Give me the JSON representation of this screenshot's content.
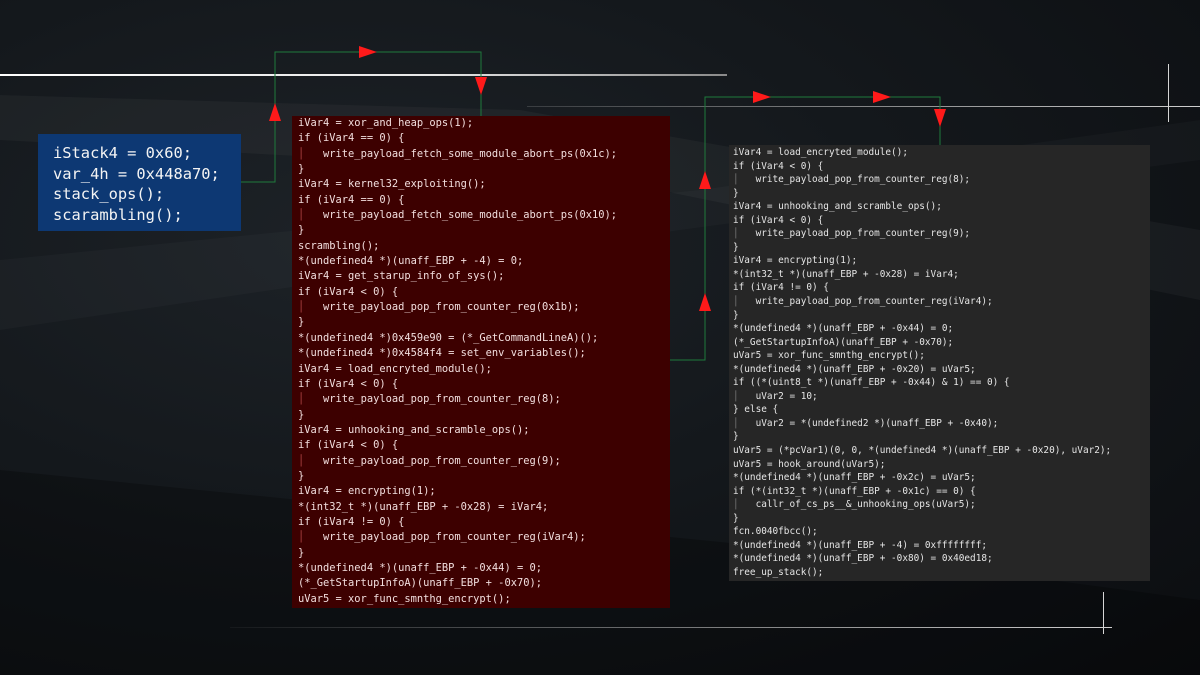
{
  "intro_block": {
    "lines": [
      "iStack4 = 0x60;",
      "var_4h = 0x448a70;",
      "stack_ops();",
      "scarambling();"
    ]
  },
  "main_block": {
    "lines": [
      "iVar4 = xor_and_heap_ops(1);",
      "if (iVar4 == 0) {",
      "    write_payload_fetch_some_module_abort_ps(0x1c);",
      "}",
      "iVar4 = kernel32_exploiting();",
      "if (iVar4 == 0) {",
      "    write_payload_fetch_some_module_abort_ps(0x10);",
      "}",
      "scrambling();",
      "*(undefined4 *)(unaff_EBP + -4) = 0;",
      "iVar4 = get_starup_info_of_sys();",
      "if (iVar4 < 0) {",
      "    write_payload_pop_from_counter_reg(0x1b);",
      "}",
      "*(undefined4 *)0x459e90 = (*_GetCommandLineA)();",
      "*(undefined4 *)0x4584f4 = set_env_variables();",
      "iVar4 = load_encryted_module();",
      "if (iVar4 < 0) {",
      "    write_payload_pop_from_counter_reg(8);",
      "}",
      "iVar4 = unhooking_and_scramble_ops();",
      "if (iVar4 < 0) {",
      "    write_payload_pop_from_counter_reg(9);",
      "}",
      "iVar4 = encrypting(1);",
      "*(int32_t *)(unaff_EBP + -0x28) = iVar4;",
      "if (iVar4 != 0) {",
      "    write_payload_pop_from_counter_reg(iVar4);",
      "}",
      "*(undefined4 *)(unaff_EBP + -0x44) = 0;",
      "(*_GetStartupInfoA)(unaff_EBP + -0x70);",
      "uVar5 = xor_func_smnthg_encrypt();"
    ]
  },
  "right_block": {
    "lines": [
      "iVar4 = load_encryted_module();",
      "if (iVar4 < 0) {",
      "    write_payload_pop_from_counter_reg(8);",
      "}",
      "iVar4 = unhooking_and_scramble_ops();",
      "if (iVar4 < 0) {",
      "    write_payload_pop_from_counter_reg(9);",
      "}",
      "iVar4 = encrypting(1);",
      "*(int32_t *)(unaff_EBP + -0x28) = iVar4;",
      "if (iVar4 != 0) {",
      "    write_payload_pop_from_counter_reg(iVar4);",
      "}",
      "*(undefined4 *)(unaff_EBP + -0x44) = 0;",
      "(*_GetStartupInfoA)(unaff_EBP + -0x70);",
      "uVar5 = xor_func_smnthg_encrypt();",
      "*(undefined4 *)(unaff_EBP + -0x20) = uVar5;",
      "if ((*(uint8_t *)(unaff_EBP + -0x44) & 1) == 0) {",
      "    uVar2 = 10;",
      "} else {",
      "    uVar2 = *(undefined2 *)(unaff_EBP + -0x40);",
      "}",
      "uVar5 = (*pcVar1)(0, 0, *(undefined4 *)(unaff_EBP + -0x20), uVar2);",
      "uVar5 = hook_around(uVar5);",
      "*(undefined4 *)(unaff_EBP + -0x2c) = uVar5;",
      "if (*(int32_t *)(unaff_EBP + -0x1c) == 0) {",
      "    callr_of_cs_ps__&_unhooking_ops(uVar5);",
      "}",
      "fcn.0040fbcc();",
      "*(undefined4 *)(unaff_EBP + -4) = 0xffffffff;",
      "*(undefined4 *)(unaff_EBP + -0x80) = 0x40ed18;",
      "free_up_stack();"
    ]
  },
  "colors": {
    "flow_edge": "#1f7a3c",
    "arrow_head": "#ff1a1a",
    "intro_block_bg": "#0d3873",
    "main_block_bg": "#3d0000",
    "right_block_bg": "#262626"
  },
  "icons": [
    "arrow-head-icon"
  ]
}
